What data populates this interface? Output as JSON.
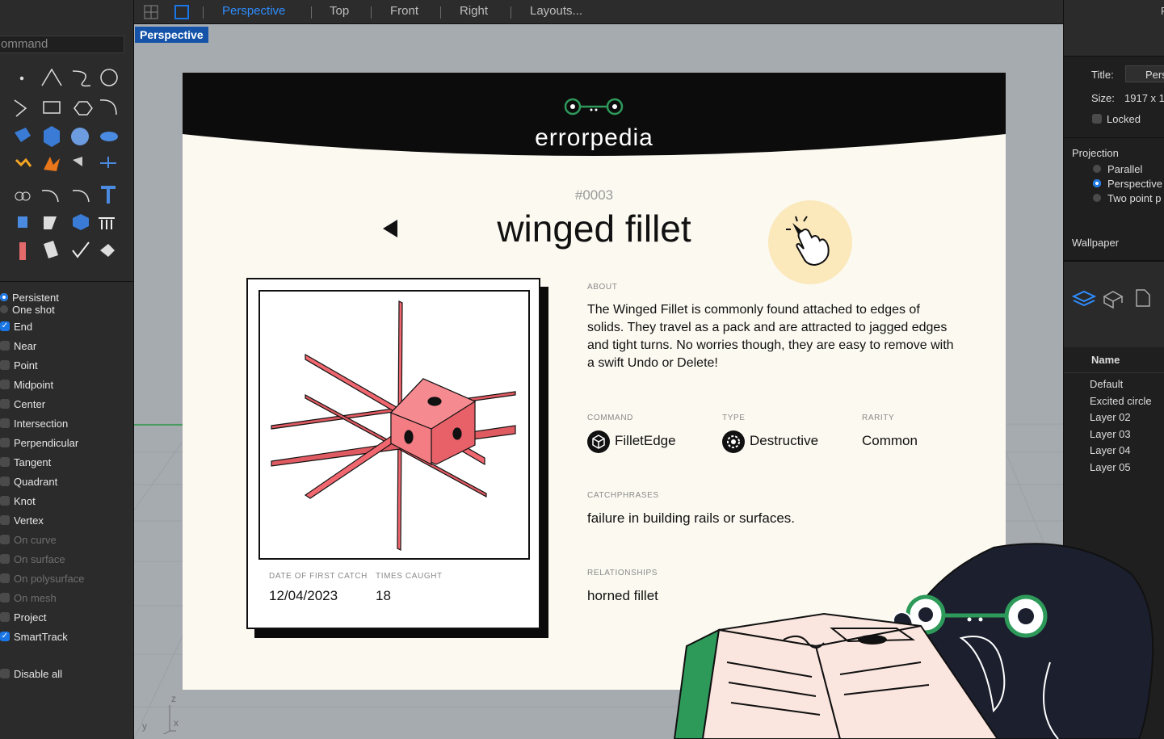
{
  "left_panel": {
    "command_placeholder": "ommand",
    "osnap_mode": [
      {
        "label": "Persistent",
        "on": true
      },
      {
        "label": "One shot",
        "on": false
      }
    ],
    "osnaps": [
      {
        "label": "End",
        "on": true,
        "dim": false
      },
      {
        "label": "Near",
        "on": false,
        "dim": false
      },
      {
        "label": "Point",
        "on": false,
        "dim": false
      },
      {
        "label": "Midpoint",
        "on": false,
        "dim": false
      },
      {
        "label": "Center",
        "on": false,
        "dim": false
      },
      {
        "label": "Intersection",
        "on": false,
        "dim": false
      },
      {
        "label": "Perpendicular",
        "on": false,
        "dim": false
      },
      {
        "label": "Tangent",
        "on": false,
        "dim": false
      },
      {
        "label": "Quadrant",
        "on": false,
        "dim": false
      },
      {
        "label": "Knot",
        "on": false,
        "dim": false
      },
      {
        "label": "Vertex",
        "on": false,
        "dim": false
      },
      {
        "label": "On curve",
        "on": false,
        "dim": true
      },
      {
        "label": "On surface",
        "on": false,
        "dim": true
      },
      {
        "label": "On polysurface",
        "on": false,
        "dim": true
      },
      {
        "label": "On mesh",
        "on": false,
        "dim": true
      },
      {
        "label": "Project",
        "on": false,
        "dim": false
      },
      {
        "label": "SmartTrack",
        "on": true,
        "dim": false
      }
    ],
    "disable_all": "Disable all"
  },
  "tabs": {
    "perspective": "Perspective",
    "top": "Top",
    "front": "Front",
    "right": "Right",
    "layouts": "Layouts..."
  },
  "viewport": {
    "tag": "Perspective",
    "axis_z": "z",
    "axis_y": "y",
    "axis_x": "x"
  },
  "right_panel": {
    "title_label": "Title:",
    "title_value": "Perspe",
    "size_label": "Size:",
    "size_value": "1917 x 1",
    "locked": "Locked",
    "projection": "Projection",
    "proj_options": [
      "Parallel",
      "Perspective",
      "Two point p"
    ],
    "wallpaper": "Wallpaper",
    "layers_header": "Name",
    "layers": [
      "Default",
      "Excited circle",
      "Layer 02",
      "Layer 03",
      "Layer 04",
      "Layer 05"
    ]
  },
  "card": {
    "logo": "errorpedia",
    "number": "#0003",
    "title": "winged fillet",
    "date_label": "DATE OF FIRST CATCH",
    "date_value": "12/04/2023",
    "times_label": "TIMES CAUGHT",
    "times_value": "18",
    "about_label": "ABOUT",
    "about_text": "The Winged Fillet is commonly found attached to edges of solids. They travel as a pack and are attracted to jagged edges and tight turns. No worries though, they are easy to remove with a swift Undo or Delete!",
    "command_label": "COMMAND",
    "command_value": "FilletEdge",
    "type_label": "TYPE",
    "type_value": "Destructive",
    "rarity_label": "RARITY",
    "rarity_value": "Common",
    "catch_label": "CATCHPHRASES",
    "catch_value": "failure in building rails or surfaces.",
    "rel_label": "RELATIONSHIPS",
    "rel_value": "horned fillet"
  },
  "colors": {
    "accent_blue": "#1a76e4",
    "creature_red": "#f0676f",
    "mascot_green": "#2e9a5a",
    "card_bg": "#fbf9f0"
  }
}
